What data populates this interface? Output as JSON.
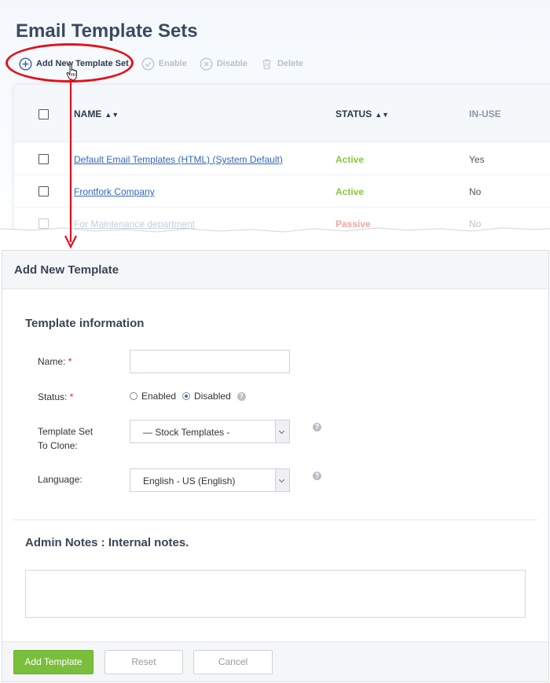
{
  "page": {
    "title": "Email Template Sets"
  },
  "toolbar": {
    "add": "Add New Template Set",
    "enable": "Enable",
    "disable": "Disable",
    "delete": "Delete"
  },
  "table": {
    "columns": {
      "name": "NAME",
      "status": "STATUS",
      "inuse": "IN-USE"
    },
    "rows": [
      {
        "name": "Default Email Templates (HTML) (System Default)",
        "status": "Active",
        "inuse": "Yes"
      },
      {
        "name": "Frontfork Company",
        "status": "Active",
        "inuse": "No"
      },
      {
        "name": "For Maintenance department",
        "status": "Passive",
        "inuse": "No"
      }
    ]
  },
  "dialog": {
    "title": "Add New Template",
    "section_info": "Template information",
    "name_label": "Name:",
    "name_value": "",
    "status_label": "Status:",
    "status_enabled": "Enabled",
    "status_disabled": "Disabled",
    "status_selected": "Disabled",
    "clone_label_line1": "Template Set",
    "clone_label_line2": "To Clone:",
    "clone_value": "— Stock Templates -",
    "language_label": "Language:",
    "language_value": "English - US (English)",
    "required_mark": "*",
    "help_mark": "?",
    "section_notes": "Admin Notes : Internal notes.",
    "notes_value": "",
    "add_button": "Add Template",
    "reset_button": "Reset",
    "cancel_button": "Cancel"
  },
  "colors": {
    "active": "#8cc63f",
    "passive": "#f4a5a5",
    "highlight": "#e3101c",
    "primary_button": "#79bf3c",
    "title": "#3b4a63"
  },
  "icons": [
    "plus-circle-icon",
    "check-circle-icon",
    "x-circle-icon",
    "trash-icon",
    "hand-cursor-icon",
    "sort-icon",
    "help-icon",
    "chevron-down-icon"
  ]
}
